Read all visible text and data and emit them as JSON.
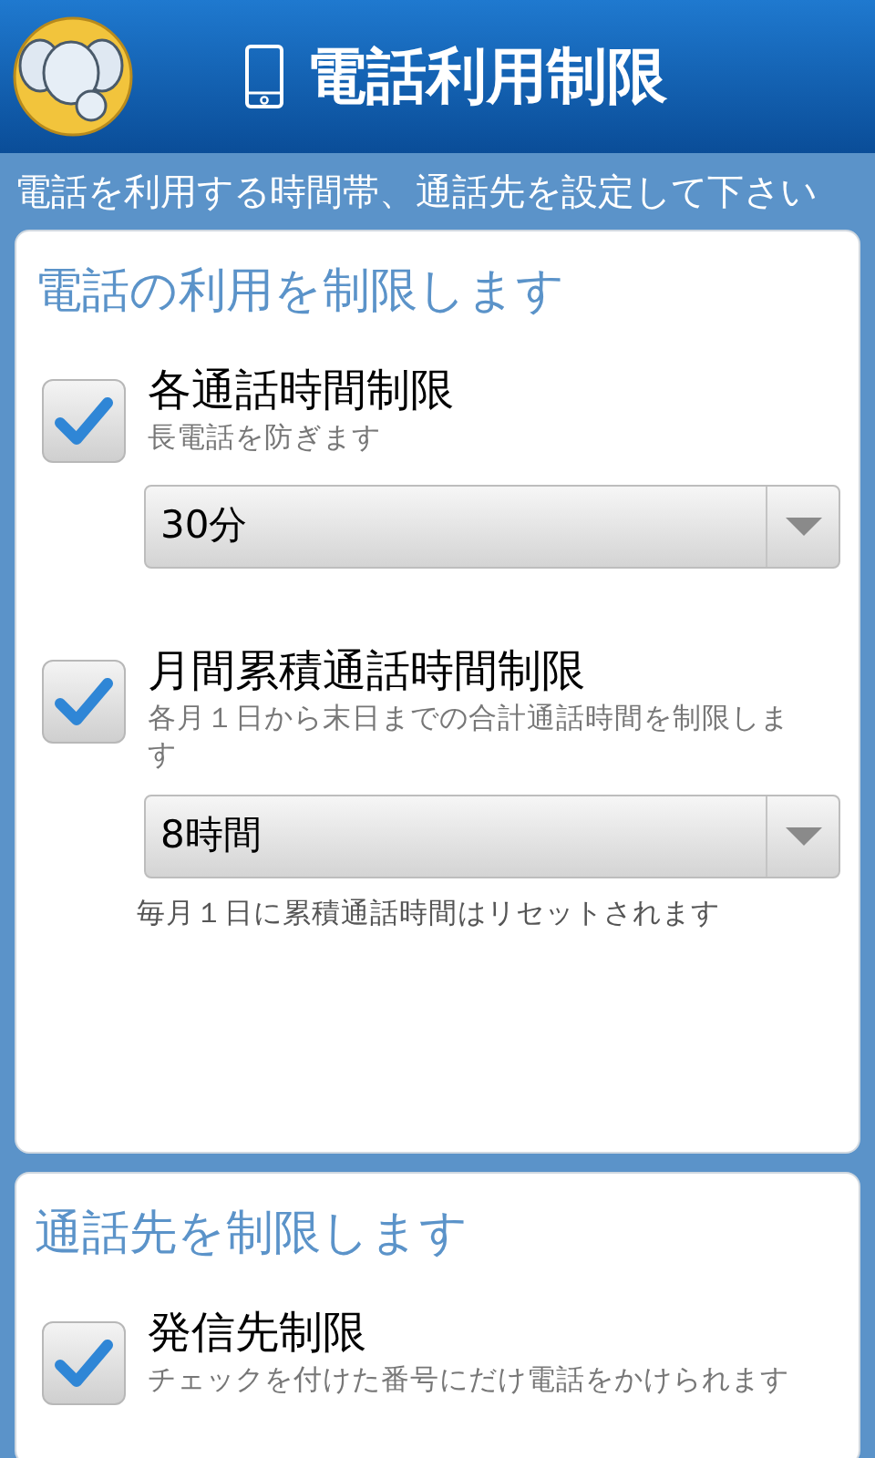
{
  "header": {
    "title": "電話利用制限"
  },
  "subtitle": "電話を利用する時間帯、通話先を設定して下さい",
  "sections": [
    {
      "title": "電話の利用を制限します",
      "options": [
        {
          "label": "各通話時間制限",
          "description": "長電話を防ぎます",
          "checked": true,
          "dropdown": {
            "value": "30分"
          }
        },
        {
          "label": "月間累積通話時間制限",
          "description": "各月１日から末日までの合計通話時間を制限します",
          "checked": true,
          "dropdown": {
            "value": "8時間"
          },
          "note": "毎月１日に累積通話時間はリセットされます"
        }
      ]
    },
    {
      "title": "通話先を制限します",
      "options": [
        {
          "label": "発信先制限",
          "description": "チェックを付けた番号にだけ電話をかけられます",
          "checked": true
        }
      ]
    }
  ]
}
